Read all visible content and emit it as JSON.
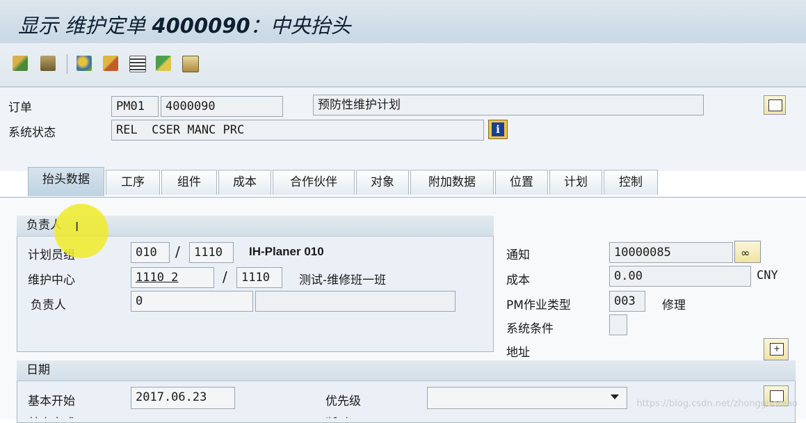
{
  "window": {
    "title_prefix": "显示 维护定单",
    "title_number": "4000090",
    "title_suffix": "：中央抬头"
  },
  "toolbar": {
    "icons": [
      "display-change-icon",
      "object-list-icon",
      "operations-icon",
      "components-icon",
      "document-icon",
      "edit-icon",
      "clipboard-icon"
    ]
  },
  "header": {
    "order_label": "订单",
    "order_type": "PM01",
    "order_number": "4000090",
    "order_description": "预防性维护计划",
    "status_label": "系统状态",
    "status_value": "REL  CSER MANC PRC",
    "status_info_icon": "info-icon"
  },
  "tabs": [
    {
      "label": "抬头数据",
      "active": true
    },
    {
      "label": "工序"
    },
    {
      "label": "组件"
    },
    {
      "label": "成本"
    },
    {
      "label": "合作伙伴"
    },
    {
      "label": "对象"
    },
    {
      "label": "附加数据"
    },
    {
      "label": "位置"
    },
    {
      "label": "计划"
    },
    {
      "label": "控制"
    }
  ],
  "responsible": {
    "group_title": "负责人",
    "planner_group_label": "计划员组",
    "planner_group": "010",
    "planner_plant": "1110",
    "planner_group_text": "IH-Planer 010",
    "work_center_label": "维护中心",
    "work_center": "1110 2",
    "work_center_plant": "1110",
    "work_center_text": "测试-维修班一班",
    "person_label": "负责人",
    "person_value": "0",
    "person_text": ""
  },
  "right_panel": {
    "notification_label": "通知",
    "notification_value": "10000085",
    "cost_label": "成本",
    "cost_value": "0.00",
    "currency": "CNY",
    "activity_type_label": "PM作业类型",
    "activity_type_value": "003",
    "activity_type_text": "修理",
    "sys_condition_label": "系统条件",
    "address_label": "地址"
  },
  "dates": {
    "group_title": "日期",
    "basic_start_label": "基本开始",
    "basic_start_value": "2017.06.23",
    "priority_label": "优先级",
    "priority_value": "",
    "cutoff_row_label": "基本完成",
    "cutoff_row_right_label": "断时"
  },
  "watermark": "https://blog.csdn.net/zhongguomao",
  "colors": {
    "title_bar": "#c9d8e4",
    "highlight": "#f0eb28",
    "button_yellow": "#f0e3a6"
  }
}
